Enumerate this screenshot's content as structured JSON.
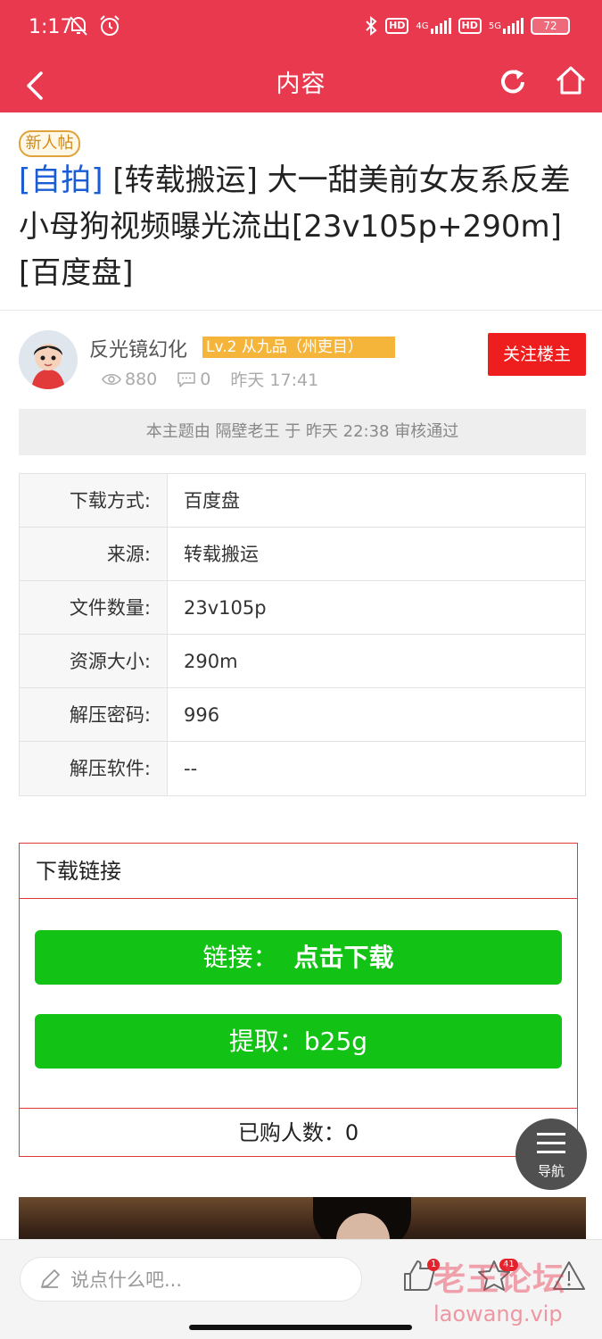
{
  "status_bar": {
    "time": "1:17",
    "hd1": "HD",
    "net1": "4G",
    "hd2": "HD",
    "net2": "5G",
    "battery": "72"
  },
  "header": {
    "title": "内容"
  },
  "post": {
    "new_badge": "新人帖",
    "title_tag": "[自拍]",
    "title_rest": " [转载搬运] 大一甜美前女友系反差小母狗视频曝光流出[23v105p+290m][百度盘]"
  },
  "author": {
    "name": "反光镜幻化",
    "level": "Lv.2 从九品（州吏目）",
    "views": "880",
    "comments": "0",
    "time": "昨天 17:41",
    "follow_label": "关注楼主"
  },
  "review_notice": "本主题由 隔壁老王 于 昨天 22:38 审核通过",
  "info_table": [
    {
      "key": "下载方式:",
      "value": "百度盘"
    },
    {
      "key": "来源:",
      "value": "转载搬运"
    },
    {
      "key": "文件数量:",
      "value": "23v105p"
    },
    {
      "key": "资源大小:",
      "value": "290m"
    },
    {
      "key": "解压密码:",
      "value": "996"
    },
    {
      "key": "解压软件:",
      "value": "--"
    }
  ],
  "download": {
    "heading": "下载链接",
    "link_prefix": "链接：",
    "link_action": "点击下载",
    "extract_label": "提取：b25g",
    "bought": "已购人数：0"
  },
  "nav_fab": {
    "label": "导航"
  },
  "bottom_bar": {
    "comment_placeholder": "说点什么吧...",
    "like_count": "1",
    "fav_count": "41"
  },
  "watermark": {
    "cn": "老王论坛",
    "url": "laowang.vip"
  },
  "colors": {
    "brand": "#e8394f",
    "download_green": "#12c214",
    "follow_red": "#ef1e1e",
    "level_orange": "#f5b43a"
  }
}
